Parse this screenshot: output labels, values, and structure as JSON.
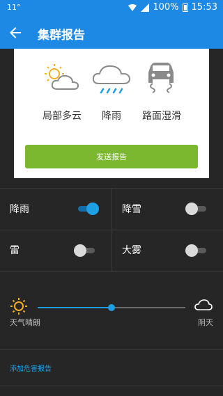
{
  "status_bar": {
    "left_text": "11°",
    "battery": "100%",
    "time": "15:53"
  },
  "app_bar": {
    "title": "集群报告"
  },
  "card": {
    "conditions": [
      {
        "label": "局部多云",
        "icon": "partly-cloudy-icon"
      },
      {
        "label": "降雨",
        "icon": "rain-icon"
      },
      {
        "label": "路面湿滑",
        "icon": "slippery-road-icon"
      }
    ],
    "send_label": "发送报告"
  },
  "toggles": [
    {
      "label": "降雨",
      "on": true
    },
    {
      "label": "降雪",
      "on": false
    },
    {
      "label": "雷",
      "on": false
    },
    {
      "label": "大雾",
      "on": false
    }
  ],
  "slider": {
    "left_label": "天气晴朗",
    "right_label": "阴天",
    "value": 0.5
  },
  "hazard_link": "添加危害报告",
  "colors": {
    "primary": "#1e88e5",
    "accent": "#1f9fe3",
    "send_button": "#7cb82f"
  }
}
